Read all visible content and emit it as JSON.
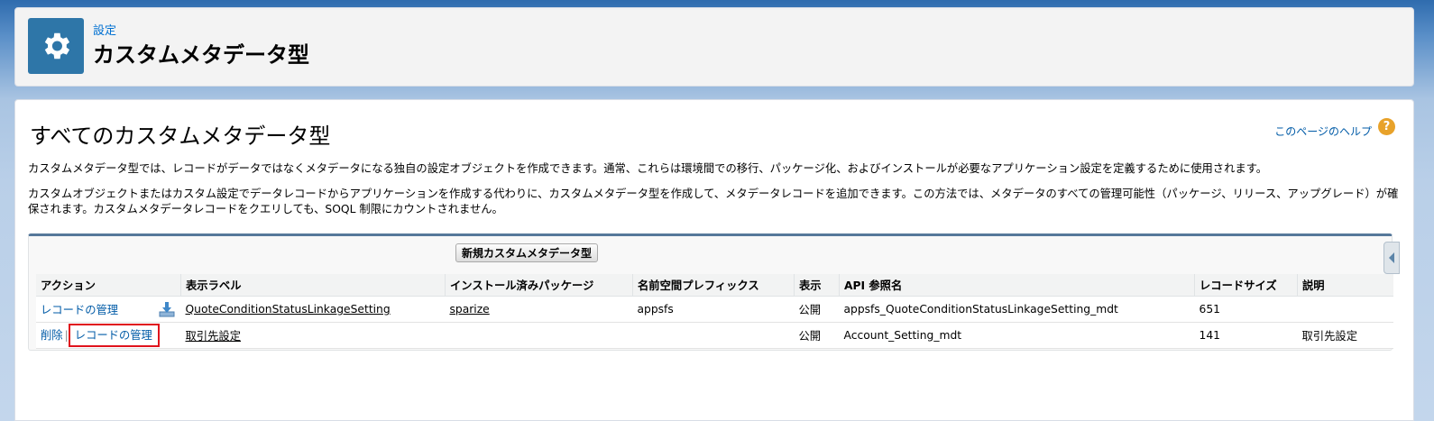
{
  "header": {
    "breadcrumb": "設定",
    "title": "カスタムメタデータ型",
    "icon": "gear-icon"
  },
  "main": {
    "heading": "すべてのカスタムメタデータ型",
    "help_link": "このページのヘルプ",
    "help_icon": "?",
    "description1": "カスタムメタデータ型では、レコードがデータではなくメタデータになる独自の設定オブジェクトを作成できます。通常、これらは環境間での移行、パッケージ化、およびインストールが必要なアプリケーション設定を定義するために使用されます。",
    "description2": "カスタムオブジェクトまたはカスタム設定でデータレコードからアプリケーションを作成する代わりに、カスタムメタデータ型を作成して、メタデータレコードを追加できます。この方法では、メタデータのすべての管理可能性（パッケージ、リリース、アップグレード）が確保されます。カスタムメタデータレコードをクエリしても、SOQL 制限にカウントされません。"
  },
  "list": {
    "new_button": "新規カスタムメタデータ型",
    "columns": [
      "アクション",
      "表示ラベル",
      "インストール済みパッケージ",
      "名前空間プレフィックス",
      "表示",
      "API 参照名",
      "レコードサイズ",
      "説明"
    ],
    "rows": [
      {
        "action_manage": "レコードの管理",
        "label": "QuoteConditionStatusLinkageSetting",
        "package": "sparize",
        "namespace": "appsfs",
        "visibility": "公開",
        "api_name": "appsfs_QuoteConditionStatusLinkageSetting_mdt",
        "record_size": "651",
        "description": ""
      },
      {
        "action_delete": "削除",
        "action_manage": "レコードの管理",
        "label": "取引先設定",
        "package": "",
        "namespace": "",
        "visibility": "公開",
        "api_name": "Account_Setting_mdt",
        "record_size": "141",
        "description": "取引先設定"
      }
    ]
  },
  "colors": {
    "accent": "#2e76a8",
    "link": "#015ba7",
    "highlight": "#e0131c"
  }
}
